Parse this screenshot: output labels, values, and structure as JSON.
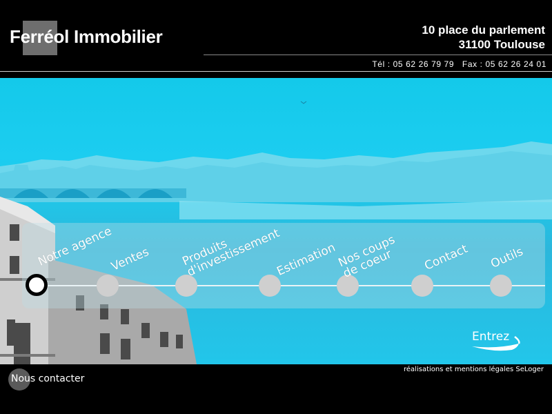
{
  "header": {
    "brand": "Ferréol Immobilier",
    "address_line1": "10 place du parlement",
    "address_line2": "31100 Toulouse",
    "contact_line": "Tél : 05 62 26 79 79   Fax : 05 62 26 24 01"
  },
  "nav": {
    "items": [
      {
        "label": "Notre agence",
        "active": true
      },
      {
        "label": "Ventes",
        "active": false
      },
      {
        "label": "Produits\nd'investissement",
        "active": false
      },
      {
        "label": "Estimation",
        "active": false
      },
      {
        "label": "Nos coups\nde coeur",
        "active": false
      },
      {
        "label": "Contact",
        "active": false
      },
      {
        "label": "Outils",
        "active": false
      }
    ],
    "enter_label": "Entrez"
  },
  "footer": {
    "legal": "réalisations et mentions légales SeLoger",
    "contact_label": "Nous contacter"
  },
  "colors": {
    "sky": "#1ccdf0",
    "river": "#22c6ea",
    "background": "#000000"
  }
}
